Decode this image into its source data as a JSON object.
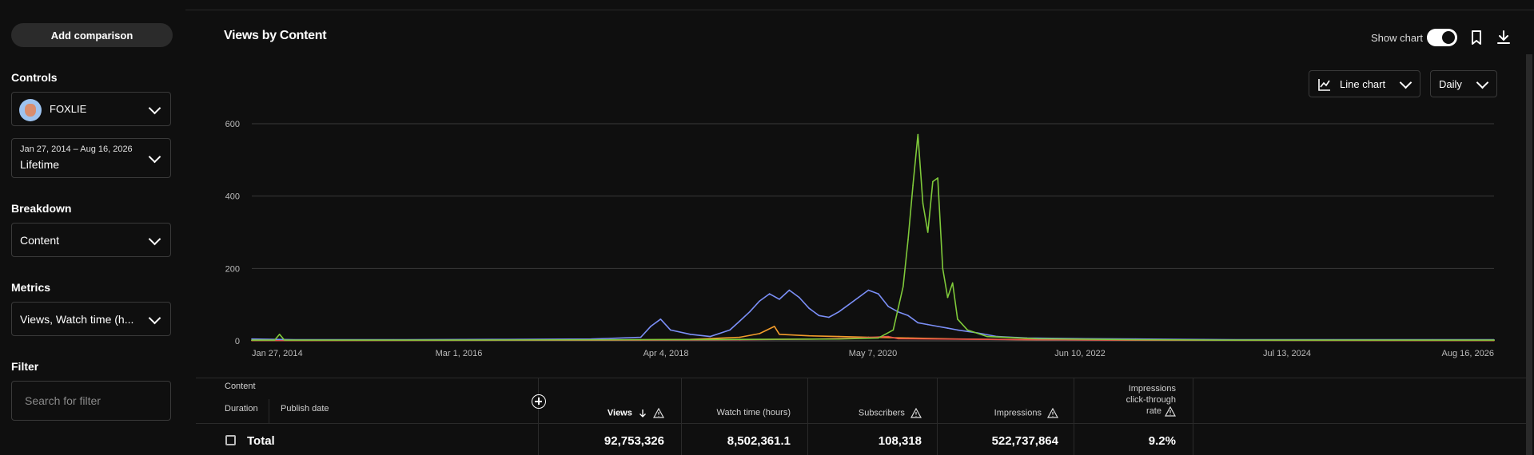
{
  "sidebar": {
    "add_comparison": "Add comparison",
    "controls_title": "Controls",
    "channel_name": "FOXLIE",
    "date_range": "Jan 27, 2014 – Aug 16, 2026",
    "date_preset": "Lifetime",
    "breakdown_title": "Breakdown",
    "breakdown_value": "Content",
    "metrics_title": "Metrics",
    "metrics_value": "Views, Watch time (h...",
    "filter_title": "Filter",
    "filter_placeholder": "Search for filter"
  },
  "header": {
    "title": "Views by Content",
    "show_chart_label": "Show chart",
    "show_chart_on": true,
    "chart_type": "Line chart",
    "granularity": "Daily"
  },
  "colors": {
    "blue": "#7b8ff7",
    "green": "#7fc93a",
    "orange": "#f39c2b",
    "red": "#e8504a",
    "grid": "#3a3a3a"
  },
  "chart_data": {
    "type": "line",
    "y_ticks": [
      "600",
      "400",
      "200",
      "0"
    ],
    "x_ticks": [
      "Jan 27, 2014",
      "Mar 1, 2016",
      "Apr 4, 2018",
      "May 7, 2020",
      "Jun 10, 2022",
      "Jul 13, 2024",
      "Aug 16, 2026"
    ],
    "ylim": [
      0,
      600
    ],
    "x_range": [
      2014.07,
      2026.62
    ],
    "grid": true,
    "series": [
      {
        "color": "#7b8ff7",
        "points": [
          [
            2014.07,
            5
          ],
          [
            2014.5,
            3
          ],
          [
            2015.5,
            3
          ],
          [
            2016.5,
            4
          ],
          [
            2017.5,
            5
          ],
          [
            2018.0,
            10
          ],
          [
            2018.1,
            40
          ],
          [
            2018.2,
            60
          ],
          [
            2018.3,
            30
          ],
          [
            2018.5,
            18
          ],
          [
            2018.7,
            12
          ],
          [
            2018.9,
            30
          ],
          [
            2019.0,
            55
          ],
          [
            2019.1,
            80
          ],
          [
            2019.2,
            110
          ],
          [
            2019.3,
            130
          ],
          [
            2019.4,
            115
          ],
          [
            2019.5,
            140
          ],
          [
            2019.6,
            120
          ],
          [
            2019.7,
            90
          ],
          [
            2019.8,
            70
          ],
          [
            2019.9,
            65
          ],
          [
            2020.0,
            80
          ],
          [
            2020.1,
            100
          ],
          [
            2020.2,
            120
          ],
          [
            2020.3,
            140
          ],
          [
            2020.4,
            130
          ],
          [
            2020.5,
            95
          ],
          [
            2020.6,
            80
          ],
          [
            2020.7,
            70
          ],
          [
            2020.8,
            50
          ],
          [
            2020.9,
            45
          ],
          [
            2021.0,
            40
          ],
          [
            2021.1,
            35
          ],
          [
            2021.2,
            30
          ],
          [
            2021.4,
            22
          ],
          [
            2021.6,
            12
          ],
          [
            2021.9,
            8
          ],
          [
            2022.5,
            6
          ],
          [
            2023.0,
            5
          ],
          [
            2023.5,
            4
          ],
          [
            2024.0,
            3
          ],
          [
            2025.0,
            3
          ],
          [
            2026.0,
            3
          ],
          [
            2026.62,
            3
          ]
        ]
      },
      {
        "color": "#7fc93a",
        "points": [
          [
            2014.07,
            2
          ],
          [
            2014.3,
            2
          ],
          [
            2014.35,
            18
          ],
          [
            2014.4,
            2
          ],
          [
            2016.0,
            2
          ],
          [
            2018.0,
            3
          ],
          [
            2019.0,
            4
          ],
          [
            2020.0,
            5
          ],
          [
            2020.4,
            8
          ],
          [
            2020.55,
            30
          ],
          [
            2020.65,
            150
          ],
          [
            2020.7,
            280
          ],
          [
            2020.75,
            430
          ],
          [
            2020.8,
            570
          ],
          [
            2020.85,
            380
          ],
          [
            2020.9,
            300
          ],
          [
            2020.95,
            440
          ],
          [
            2021.0,
            450
          ],
          [
            2021.05,
            200
          ],
          [
            2021.1,
            120
          ],
          [
            2021.15,
            160
          ],
          [
            2021.2,
            60
          ],
          [
            2021.3,
            30
          ],
          [
            2021.5,
            12
          ],
          [
            2022.0,
            6
          ],
          [
            2023.0,
            3
          ],
          [
            2024.0,
            2
          ],
          [
            2026.62,
            2
          ]
        ]
      },
      {
        "color": "#f39c2b",
        "points": [
          [
            2014.07,
            1
          ],
          [
            2017.5,
            2
          ],
          [
            2018.5,
            4
          ],
          [
            2019.0,
            10
          ],
          [
            2019.2,
            20
          ],
          [
            2019.35,
            40
          ],
          [
            2019.4,
            18
          ],
          [
            2019.7,
            14
          ],
          [
            2020.0,
            12
          ],
          [
            2020.3,
            10
          ],
          [
            2020.7,
            8
          ],
          [
            2021.2,
            5
          ],
          [
            2022.0,
            3
          ],
          [
            2023.0,
            2
          ],
          [
            2026.62,
            1
          ]
        ]
      },
      {
        "color": "#e8504a",
        "points": [
          [
            2014.07,
            1
          ],
          [
            2018.0,
            2
          ],
          [
            2019.0,
            3
          ],
          [
            2019.8,
            5
          ],
          [
            2020.2,
            8
          ],
          [
            2020.5,
            12
          ],
          [
            2020.6,
            6
          ],
          [
            2021.0,
            5
          ],
          [
            2022.0,
            3
          ],
          [
            2023.0,
            2
          ],
          [
            2026.62,
            1
          ]
        ]
      }
    ]
  },
  "table": {
    "content_header": "Content",
    "duration_header": "Duration",
    "publish_date_header": "Publish date",
    "columns": {
      "views": "Views",
      "watch_time": "Watch time (hours)",
      "subscribers": "Subscribers",
      "impressions": "Impressions",
      "ctr_line1": "Impressions",
      "ctr_line2": "click-through",
      "ctr_line3": "rate"
    },
    "total": {
      "label": "Total",
      "views": "92,753,326",
      "watch_time": "8,502,361.1",
      "subscribers": "108,318",
      "impressions": "522,737,864",
      "ctr": "9.2%"
    }
  }
}
